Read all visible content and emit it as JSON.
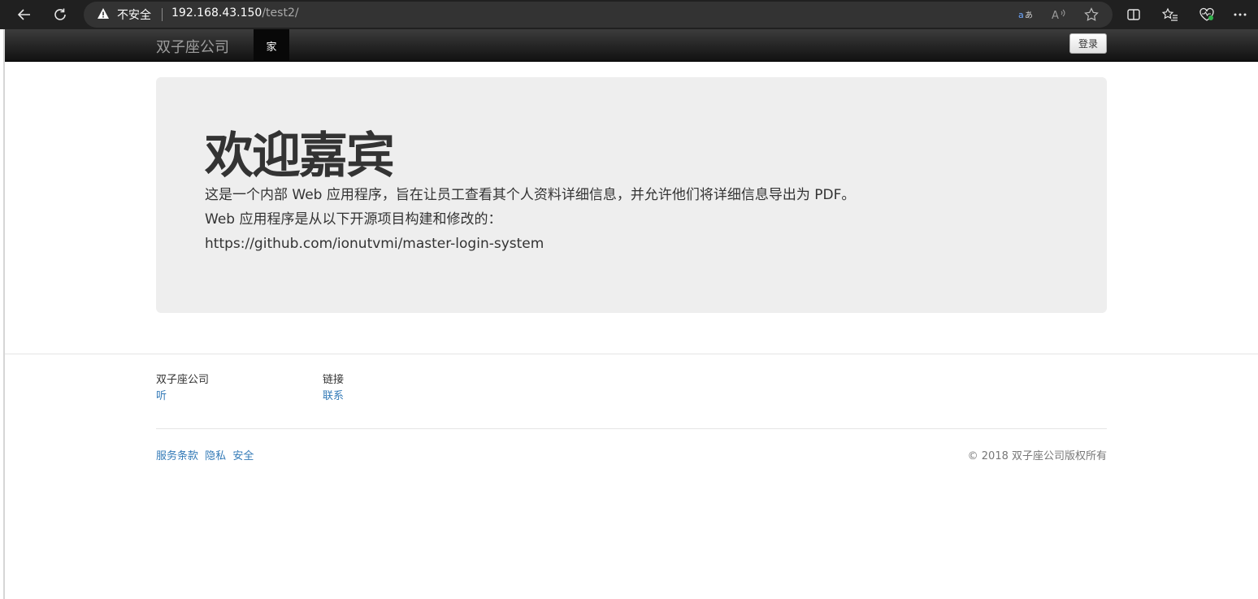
{
  "browser": {
    "security_label": "不安全",
    "url_host": "192.168.43.150",
    "url_path": "/test2/",
    "icons": [
      "back-arrow-icon",
      "reload-icon",
      "warning-icon",
      "read-aloud-icon",
      "translate-icon",
      "favorite-star-icon",
      "split-screen-icon",
      "favorites-list-icon",
      "browser-essentials-icon",
      "more-icon"
    ]
  },
  "navbar": {
    "brand": "双子座公司",
    "home_label": "家",
    "login_label": "登录"
  },
  "jumbotron": {
    "heading": "欢迎嘉宾",
    "line1": "这是一个内部 Web 应用程序，旨在让员工查看其个人资料详细信息，并允许他们将详细信息导出为 PDF。",
    "line2": "Web 应用程序是从以下开源项目构建和修改的：",
    "line3": "https://github.com/ionutvmi/master-login-system"
  },
  "footer": {
    "col1_heading": "双子座公司",
    "col1_link": "听",
    "col2_heading": "链接",
    "col2_link": "联系",
    "bottom_links": [
      "服务条款",
      "隐私",
      "安全"
    ],
    "copyright": "© 2018 双子座公司版权所有"
  },
  "colors": {
    "chrome_bg": "#202020",
    "navbar_bg": "#222222",
    "jumbotron_bg": "#eeeeee",
    "link": "#337ab7"
  }
}
